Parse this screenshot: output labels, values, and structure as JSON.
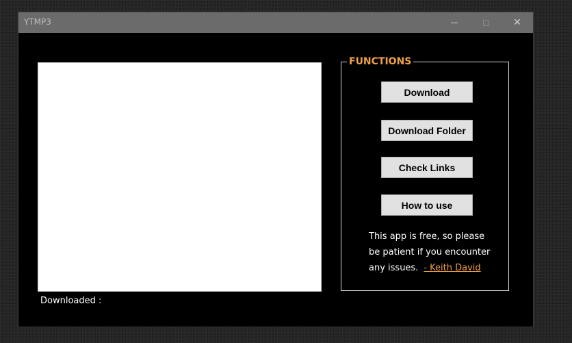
{
  "window": {
    "title": "YTMP3",
    "controls": {
      "minimize_icon": "minimize-icon",
      "maximize_icon": "maximize-icon",
      "close_glyph": "✕"
    }
  },
  "main": {
    "downloaded_label": "Downloaded :"
  },
  "functions": {
    "title": "FUNCTIONS",
    "buttons": [
      {
        "label": "Download"
      },
      {
        "label": "Download Folder"
      },
      {
        "label": "Check Links"
      },
      {
        "label": "How to use"
      }
    ],
    "note": {
      "line1": "This app is free, so please",
      "line2": "be patient if you encounter",
      "line3": "any issues.",
      "author_link": "- Keith David"
    }
  },
  "colors": {
    "accent": "#f0a04b",
    "window_bg": "#000000",
    "titlebar_bg": "#6b6b6b",
    "button_bg": "#e1e1e1"
  }
}
